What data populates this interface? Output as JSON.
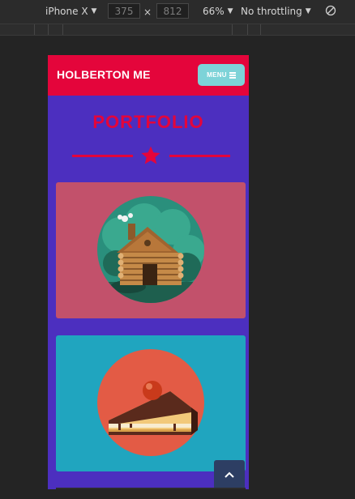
{
  "devtools": {
    "device": "iPhone X",
    "width": "375",
    "height": "812",
    "dimension_separator": "×",
    "zoom": "66%",
    "throttling": "No throttling"
  },
  "site": {
    "brand": "HOLBERTON ME",
    "menu_label": "MENU",
    "section_title": "PORTFOLIO"
  },
  "colors": {
    "header": "#e4053b",
    "page_background": "#4c2fbf",
    "menu_button": "#7dd3d8",
    "card_1": "#c2516b",
    "card_2": "#20a5bf"
  },
  "icons": [
    "chevron-down-icon",
    "rotate-icon",
    "hamburger-icon",
    "star-icon",
    "cabin-illustration",
    "cake-illustration",
    "chevron-up-icon"
  ]
}
